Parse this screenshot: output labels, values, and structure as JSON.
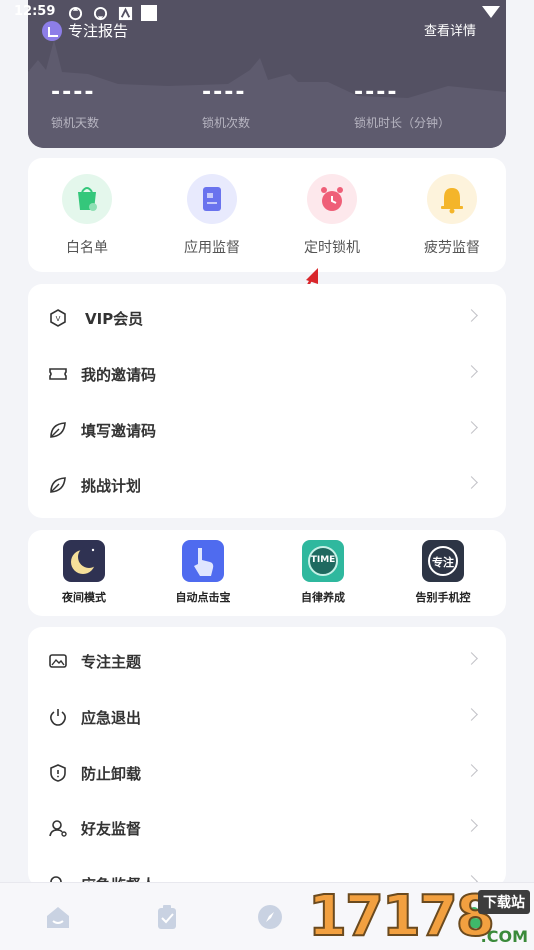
{
  "status_bar": {
    "time": "12:59"
  },
  "report": {
    "title": "专注报告",
    "detail_link": "查看详情",
    "stats": [
      {
        "value": "----",
        "label": "锁机天数"
      },
      {
        "value": "----",
        "label": "锁机次数"
      },
      {
        "value": "----",
        "label": "锁机时长（分钟）"
      }
    ]
  },
  "quick_actions": [
    {
      "label": "白名单",
      "icon": "shopping-bag-icon",
      "color": "#34c77b"
    },
    {
      "label": "应用监督",
      "icon": "document-icon",
      "color": "#6a73ee"
    },
    {
      "label": "定时锁机",
      "icon": "alarm-clock-icon",
      "color": "#ef5f78"
    },
    {
      "label": "疲劳监督",
      "icon": "bell-icon",
      "color": "#f4b52a"
    }
  ],
  "menu1": [
    {
      "label": "VIP会员",
      "icon": "vip-icon"
    },
    {
      "label": "我的邀请码",
      "icon": "ticket-icon"
    },
    {
      "label": "填写邀请码",
      "icon": "leaf-icon"
    },
    {
      "label": "挑战计划",
      "icon": "leaf-icon"
    }
  ],
  "apps": [
    {
      "label": "夜间模式",
      "icon": "moon-icon"
    },
    {
      "label": "自动点击宝",
      "icon": "tap-hand-icon"
    },
    {
      "label": "自律养成",
      "icon": "time-icon",
      "text": "TIME"
    },
    {
      "label": "告别手机控",
      "icon": "focus-icon",
      "text": "专注"
    }
  ],
  "menu2": [
    {
      "label": "专注主题",
      "icon": "image-icon"
    },
    {
      "label": "应急退出",
      "icon": "power-icon"
    },
    {
      "label": "防止卸载",
      "icon": "shield-icon"
    },
    {
      "label": "好友监督",
      "icon": "user-icon"
    },
    {
      "label": "应急监督人",
      "icon": "search-icon"
    }
  ],
  "tabs": [
    {
      "icon": "home-icon"
    },
    {
      "icon": "clipboard-icon"
    },
    {
      "icon": "compass-icon"
    },
    {
      "icon": "profile-icon"
    }
  ],
  "watermark": {
    "number": "17178",
    "tag": "下载站",
    "suffix": ".COM"
  }
}
